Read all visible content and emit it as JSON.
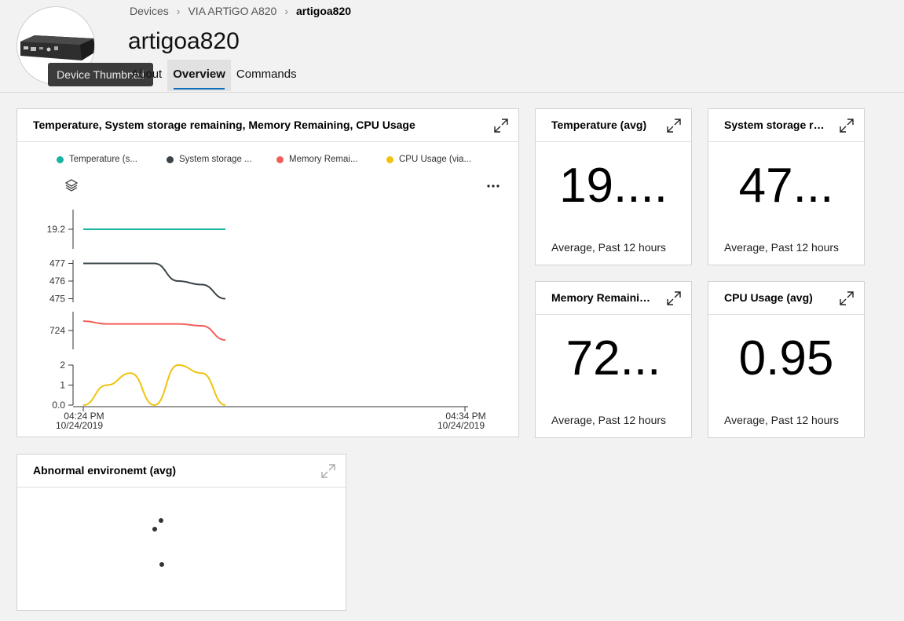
{
  "header": {
    "breadcrumb": [
      "Devices",
      "VIA ARTiGO A820",
      "artigoa820"
    ],
    "title": "artigoa820",
    "tabs": [
      "About",
      "Overview",
      "Commands"
    ],
    "active_tab": "Overview",
    "tooltip": "Device Thumbnail"
  },
  "main_chart": {
    "title": "Temperature, System storage remaining, Memory Remaining, CPU Usage",
    "legend": [
      {
        "label": "Temperature (s...",
        "color": "#1ab3a4"
      },
      {
        "label": "System storage ...",
        "color": "#3a4448"
      },
      {
        "label": "Memory Remai...",
        "color": "#f25e5a"
      },
      {
        "label": "CPU Usage (via...",
        "color": "#f0c30f"
      }
    ]
  },
  "tiles": {
    "temperature": {
      "title": "Temperature (avg)",
      "value": "19....",
      "caption": "Average, Past 12 hours"
    },
    "storage": {
      "title": "System storage re...",
      "value": "47...",
      "caption": "Average, Past 12 hours"
    },
    "memory": {
      "title": "Memory Remainin...",
      "value": "72...",
      "caption": "Average, Past 12 hours"
    },
    "cpu": {
      "title": "CPU Usage (avg)",
      "value": "0.95",
      "caption": "Average, Past 12 hours"
    }
  },
  "abnormal": {
    "title": "Abnormal environemt (avg)"
  },
  "chart_data": {
    "type": "line",
    "x_ticks": [
      {
        "time": "04:24 PM",
        "date": "10/24/2019"
      },
      {
        "time": "04:34 PM",
        "date": "10/24/2019"
      }
    ],
    "series": [
      {
        "name": "Temperature (s...",
        "color": "#1ab3a4",
        "y_ticks": [
          "19.2"
        ],
        "ylim": [
          18.2,
          20.2
        ],
        "points": [
          [
            0,
            19.2
          ],
          [
            1,
            19.2
          ],
          [
            2,
            19.2
          ],
          [
            3,
            19.2
          ],
          [
            4,
            19.2
          ],
          [
            5,
            19.2
          ],
          [
            6,
            19.2
          ]
        ]
      },
      {
        "name": "System storage ...",
        "color": "#3a4448",
        "y_ticks": [
          "477",
          "476",
          "475"
        ],
        "ylim": [
          474.8,
          477.2
        ],
        "points": [
          [
            0,
            477
          ],
          [
            1,
            477
          ],
          [
            2,
            477
          ],
          [
            3,
            477
          ],
          [
            4,
            476
          ],
          [
            5,
            475.8
          ],
          [
            6,
            475
          ]
        ]
      },
      {
        "name": "Memory Remai...",
        "color": "#f25e5a",
        "y_ticks": [
          "724"
        ],
        "ylim": [
          722,
          726
        ],
        "points": [
          [
            0,
            725
          ],
          [
            1,
            724.7
          ],
          [
            2,
            724.7
          ],
          [
            3,
            724.7
          ],
          [
            4,
            724.7
          ],
          [
            5,
            724.5
          ],
          [
            6,
            723
          ]
        ]
      },
      {
        "name": "CPU Usage (via...",
        "color": "#f0c30f",
        "y_ticks": [
          "2",
          "1",
          "0.0"
        ],
        "ylim": [
          0,
          2
        ],
        "points": [
          [
            0,
            0
          ],
          [
            1,
            1
          ],
          [
            2,
            1.6
          ],
          [
            3,
            0
          ],
          [
            4,
            2
          ],
          [
            5,
            1.6
          ],
          [
            6,
            0
          ]
        ]
      }
    ]
  }
}
